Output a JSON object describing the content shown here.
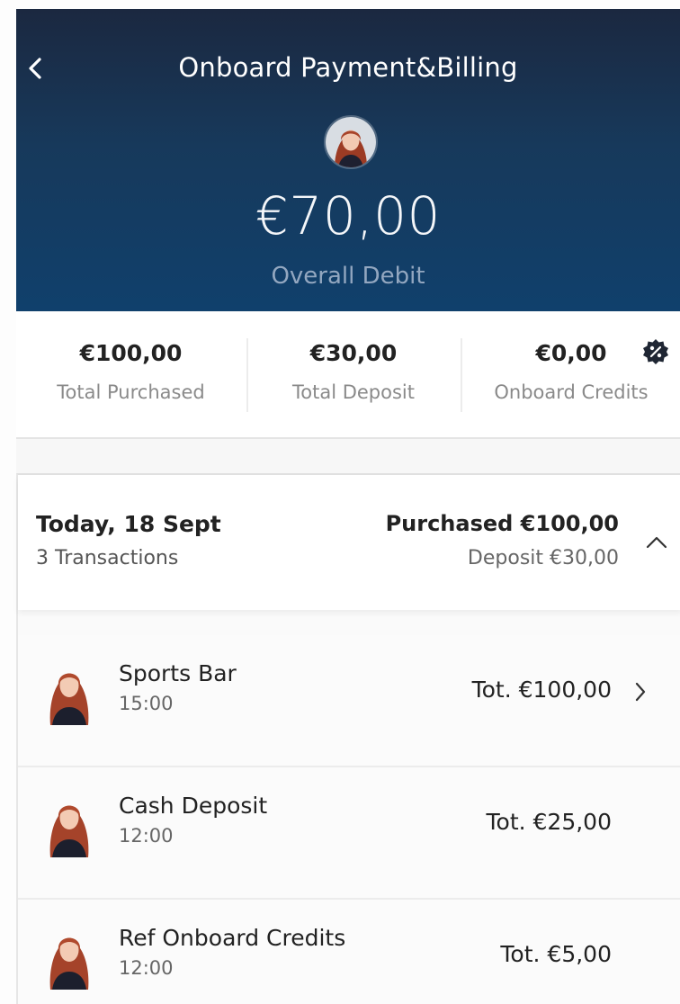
{
  "header": {
    "title": "Onboard Payment&Billing",
    "back_icon": "chevron-left-icon",
    "amount": "€70,00",
    "amount_label": "Overall Debit"
  },
  "summary": [
    {
      "value": "€100,00",
      "label": "Total Purchased"
    },
    {
      "value": "€30,00",
      "label": "Total Deposit"
    },
    {
      "value": "€0,00",
      "label": "Onboard Credits",
      "icon": "discount-badge-icon"
    }
  ],
  "day_group": {
    "title": "Today, 18 Sept",
    "count": "3 Transactions",
    "purchased": "Purchased €100,00",
    "deposit": "Deposit €30,00",
    "toggle_icon": "chevron-up-icon"
  },
  "transactions": [
    {
      "name": "Sports Bar",
      "time": "15:00",
      "total": "Tot. €100,00",
      "has_detail": true
    },
    {
      "name": "Cash Deposit",
      "time": "12:00",
      "total": "Tot. €25,00",
      "has_detail": false
    },
    {
      "name": "Ref Onboard Credits",
      "time": "12:00",
      "total": "Tot. €5,00",
      "has_detail": false
    }
  ],
  "colors": {
    "header_top": "#1b2840",
    "header_bottom": "#10406c",
    "accent_text": "#93a7c0"
  }
}
